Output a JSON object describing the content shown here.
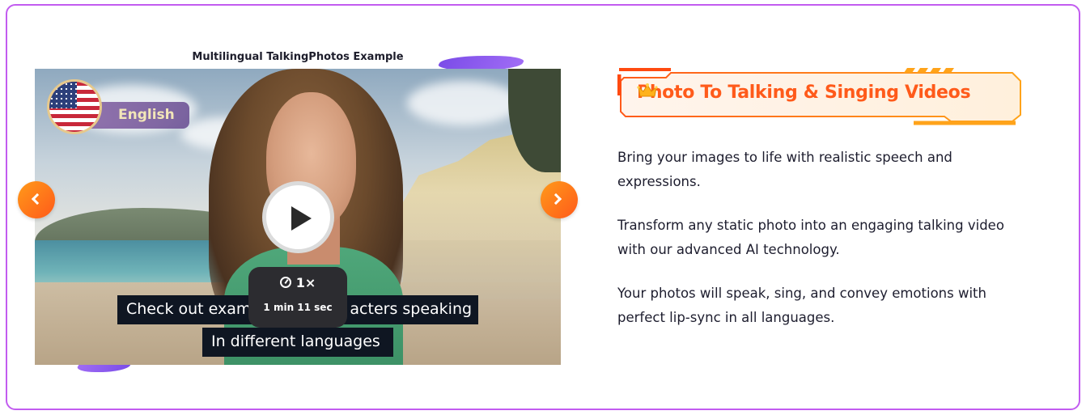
{
  "example_section": {
    "title": "Multilingual TalkingPhotos Example",
    "language_label": "English",
    "language_flag_icon": "us-flag-icon",
    "subtitle_line_1": "Check out exam",
    "subtitle_line_1_end": "acters speaking",
    "subtitle_line_2": "In different languages",
    "playback_speed": "1×",
    "duration": "1 min 11 sec",
    "prev_icon": "chevron-left-icon",
    "next_icon": "chevron-right-icon",
    "play_icon": "play-icon"
  },
  "feature": {
    "headline": "Photo To Talking & Singing Videos",
    "headline_icon": "crown-icon",
    "paragraphs": [
      "Bring your images to life with realistic speech and expressions.",
      "Transform any static photo into an engaging talking video with our advanced AI technology.",
      "Your photos will speak, sing, and convey emotions with perfect lip-sync in all languages."
    ]
  },
  "colors": {
    "frame_border": "#c25cf0",
    "accent_orange": "#ff5a1a",
    "accent_orange_light": "#ff9a1a",
    "brush_purple": "#8d5cf0",
    "text_dark": "#1d1d2e"
  }
}
